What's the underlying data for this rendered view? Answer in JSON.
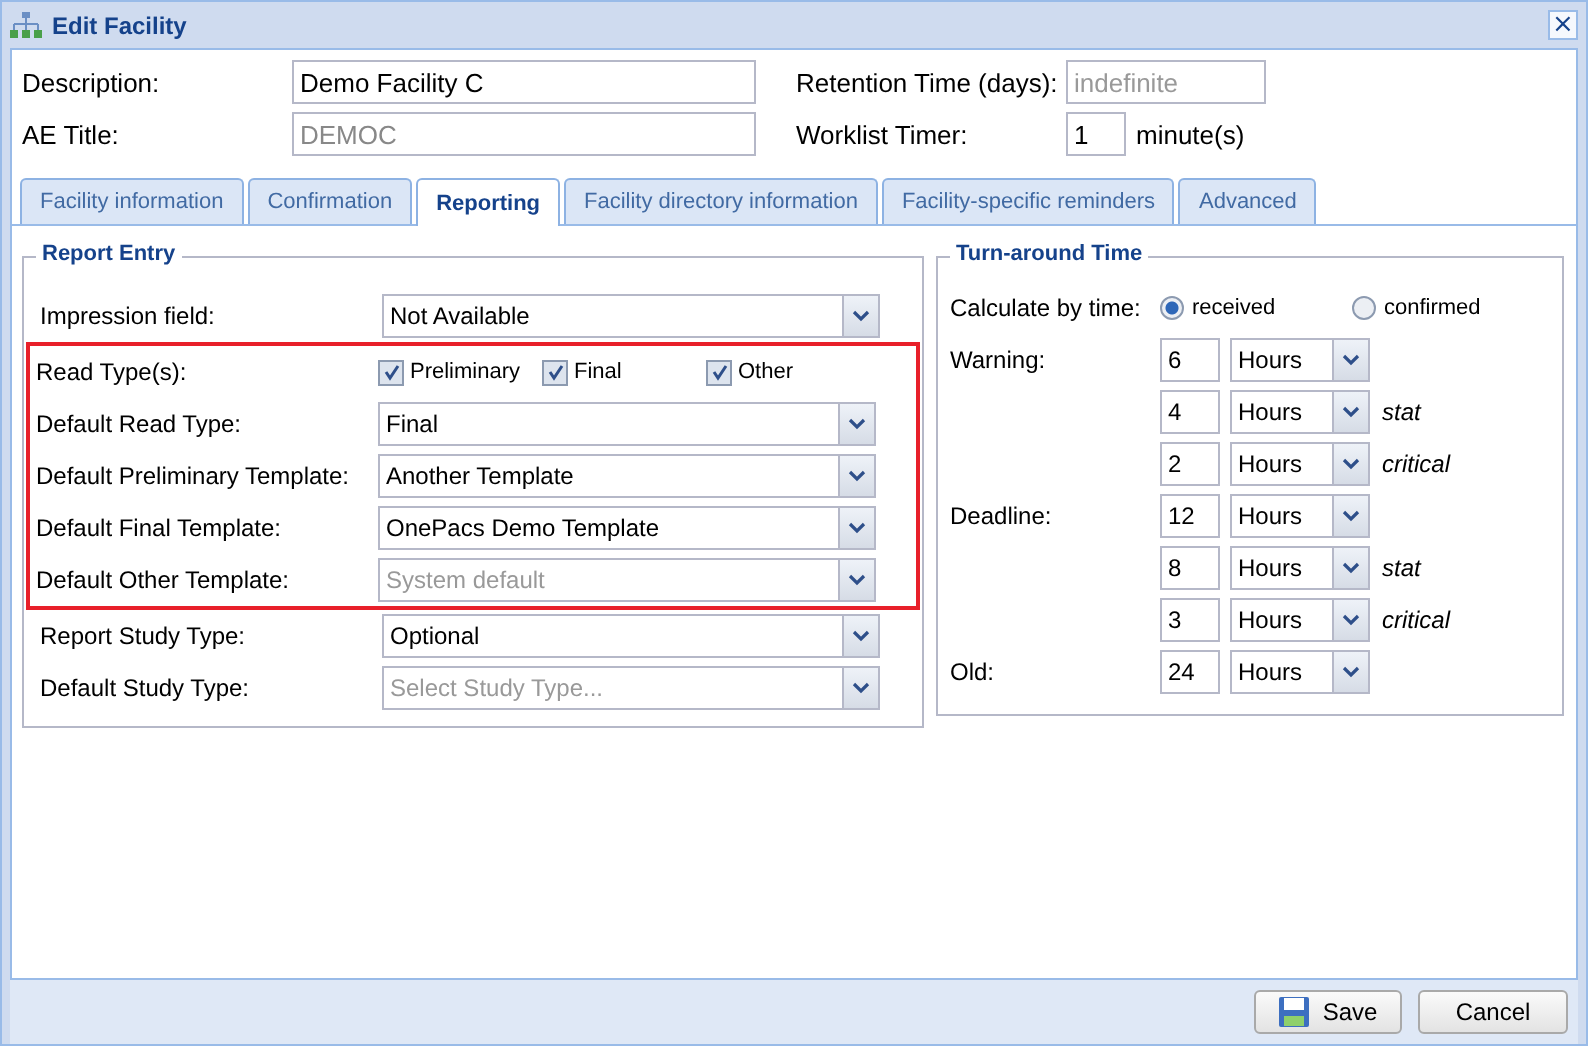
{
  "window": {
    "title": "Edit Facility",
    "close": "×"
  },
  "header": {
    "description": {
      "label": "Description:",
      "value": "Demo Facility C"
    },
    "ae_title": {
      "label": "AE Title:",
      "value": "DEMOC",
      "disabled": true
    },
    "retention": {
      "label": "Retention Time (days):",
      "placeholder": "indefinite"
    },
    "worklist_timer": {
      "label": "Worklist Timer:",
      "value": "1",
      "unit": "minute(s)"
    }
  },
  "tabs": [
    {
      "label": "Facility information",
      "selected": false
    },
    {
      "label": "Confirmation",
      "selected": false
    },
    {
      "label": "Reporting",
      "selected": true
    },
    {
      "label": "Facility directory information",
      "selected": false
    },
    {
      "label": "Facility-specific reminders",
      "selected": false
    },
    {
      "label": "Advanced",
      "selected": false
    }
  ],
  "report_entry": {
    "title": "Report Entry",
    "rows": [
      {
        "kind": "combo",
        "label": "Impression field:",
        "value": "Not Available",
        "highlighted": false
      },
      {
        "kind": "checkboxes",
        "label": "Read Type(s):",
        "highlighted": true,
        "options": [
          {
            "label": "Preliminary",
            "checked": true
          },
          {
            "label": "Final",
            "checked": true
          },
          {
            "label": "Other",
            "checked": true
          }
        ]
      },
      {
        "kind": "combo",
        "label": "Default Read Type:",
        "value": "Final",
        "highlighted": true
      },
      {
        "kind": "combo",
        "label": "Default Preliminary Template:",
        "value": "Another Template",
        "highlighted": true
      },
      {
        "kind": "combo",
        "label": "Default Final Template:",
        "value": "OnePacs Demo Template",
        "highlighted": true
      },
      {
        "kind": "combo",
        "label": "Default Other Template:",
        "placeholder": "System default",
        "highlighted": true
      },
      {
        "kind": "combo",
        "label": "Report Study Type:",
        "value": "Optional",
        "highlighted": false
      },
      {
        "kind": "combo",
        "label": "Default Study Type:",
        "placeholder": "Select Study Type...",
        "highlighted": false
      }
    ]
  },
  "turnaround": {
    "title": "Turn-around Time",
    "calc_label": "Calculate by time:",
    "radios": [
      {
        "label": "received",
        "selected": true
      },
      {
        "label": "confirmed",
        "selected": false
      }
    ],
    "rows": [
      {
        "label": "Warning:",
        "value": "6",
        "unit": "Hours"
      },
      {
        "value": "4",
        "unit": "Hours",
        "note": "stat"
      },
      {
        "value": "2",
        "unit": "Hours",
        "note": "critical"
      },
      {
        "label": "Deadline:",
        "value": "12",
        "unit": "Hours"
      },
      {
        "value": "8",
        "unit": "Hours",
        "note": "stat"
      },
      {
        "value": "3",
        "unit": "Hours",
        "note": "critical"
      },
      {
        "label": "Old:",
        "value": "24",
        "unit": "Hours"
      }
    ]
  },
  "buttons": [
    {
      "kind": "save",
      "label": "Save"
    },
    {
      "kind": "cancel",
      "label": "Cancel"
    }
  ]
}
